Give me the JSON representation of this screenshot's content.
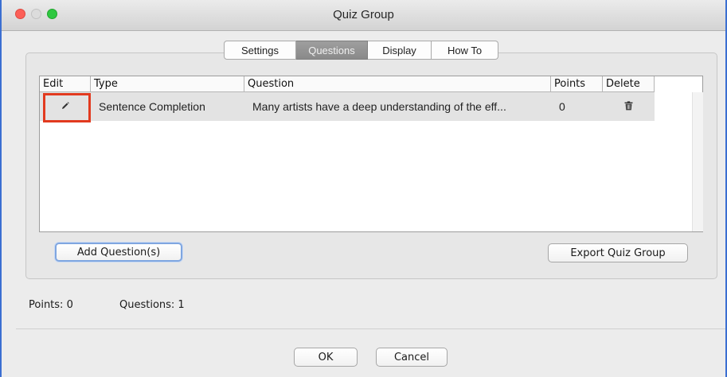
{
  "window": {
    "title": "Quiz Group"
  },
  "tabs": [
    {
      "label": "Settings",
      "active": false
    },
    {
      "label": "Questions",
      "active": true
    },
    {
      "label": "Display",
      "active": false
    },
    {
      "label": "How To",
      "active": false
    }
  ],
  "table": {
    "columns": [
      "Edit",
      "Type",
      "Question",
      "Points",
      "Delete"
    ],
    "rows": [
      {
        "edit_icon": "pencil-icon",
        "type": "Sentence Completion",
        "question": "Many artists have a deep understanding of the eff...",
        "points": "0",
        "delete_icon": "trash-icon"
      }
    ]
  },
  "buttons": {
    "add_questions": "Add Question(s)",
    "export_quiz_group": "Export Quiz Group",
    "ok": "OK",
    "cancel": "Cancel"
  },
  "status": {
    "points": "Points: 0",
    "questions": "Questions: 1"
  },
  "colors": {
    "highlight": "#e23a1f",
    "active_tab": "#8a8a8a",
    "close": "#fc5f57",
    "maximize": "#2ec840"
  }
}
